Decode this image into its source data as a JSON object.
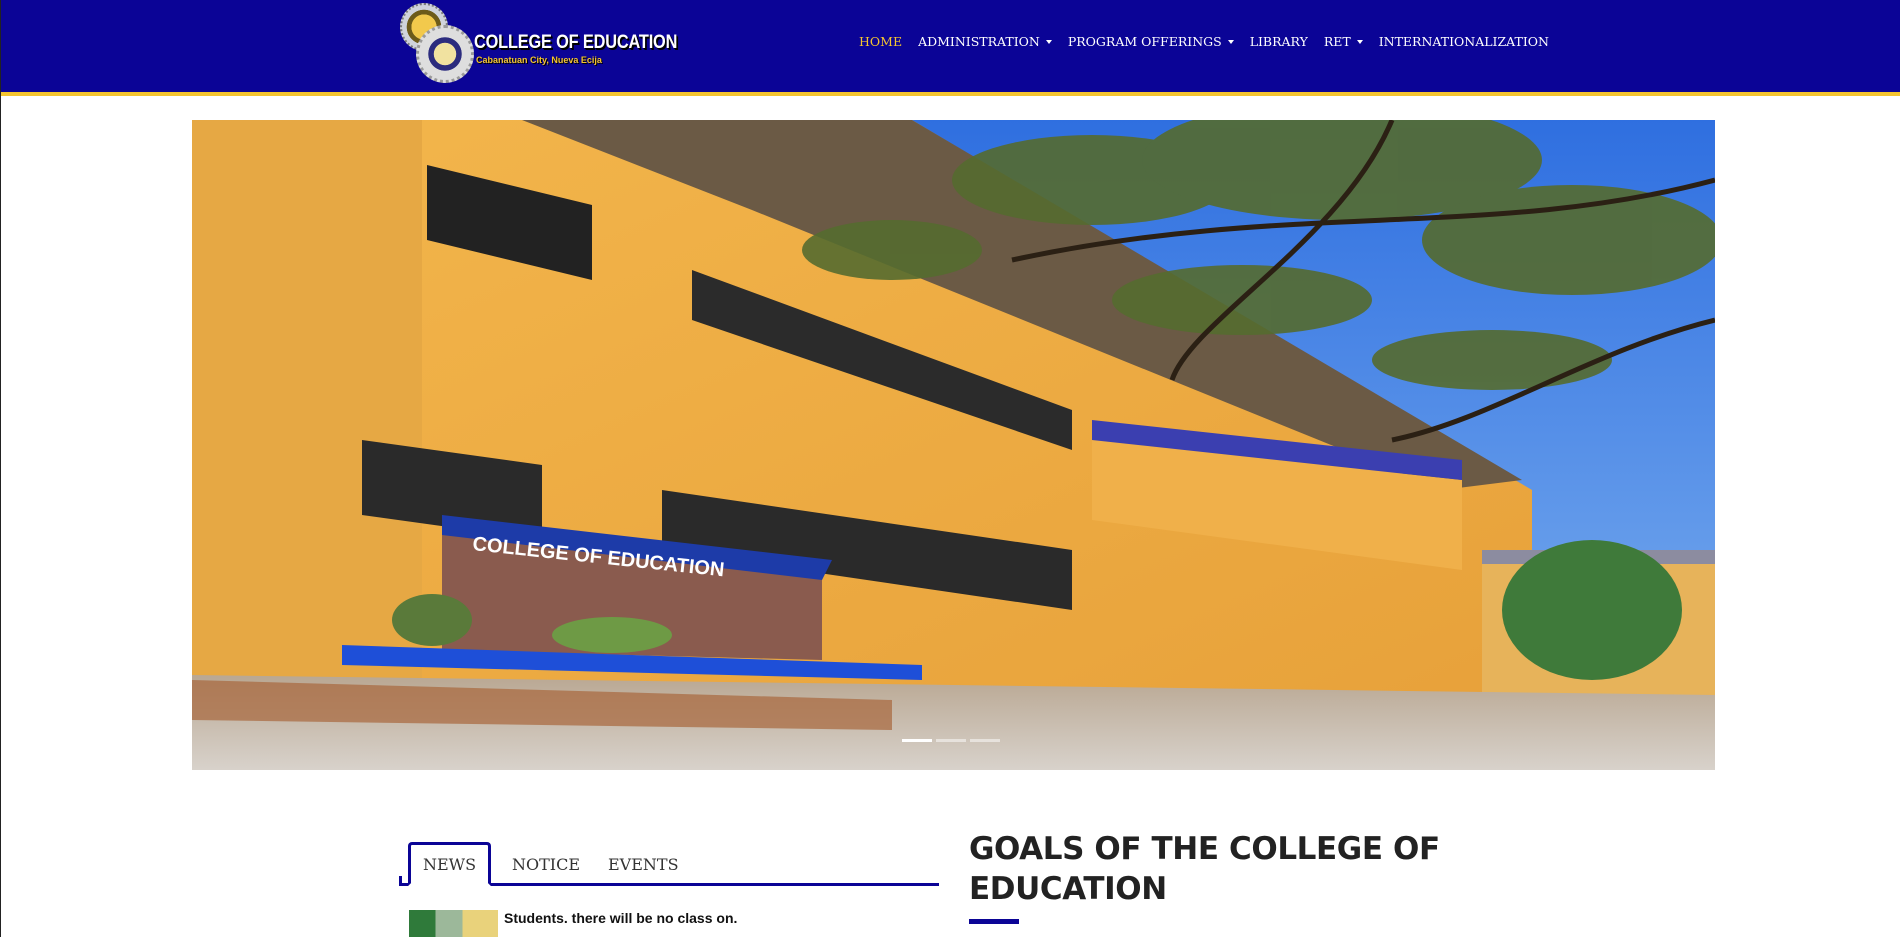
{
  "header": {
    "logo_title": "COLLEGE OF EDUCATION",
    "logo_subtitle": "Cabanatuan City, Nueva Ecija",
    "colors": {
      "bar": "#0b0496",
      "accent": "#f4c430"
    }
  },
  "nav": {
    "items": [
      {
        "label": "HOME",
        "active": true,
        "dropdown": false
      },
      {
        "label": "ADMINISTRATION",
        "active": false,
        "dropdown": true
      },
      {
        "label": "PROGRAM OFFERINGS",
        "active": false,
        "dropdown": true
      },
      {
        "label": "LIBRARY",
        "active": false,
        "dropdown": false
      },
      {
        "label": "RET",
        "active": false,
        "dropdown": true
      },
      {
        "label": "INTERNATIONALIZATION",
        "active": false,
        "dropdown": false
      }
    ]
  },
  "hero": {
    "sign_text": "COLLEGE OF EDUCATION",
    "slide_count": 3,
    "active_slide": 1
  },
  "tabs": {
    "items": [
      {
        "label": "NEWS",
        "active": true
      },
      {
        "label": "NOTICE",
        "active": false
      },
      {
        "label": "EVENTS",
        "active": false
      }
    ],
    "news_items": [
      {
        "text": "Students. there will be no class on."
      }
    ]
  },
  "goals": {
    "title_line1": "GOALS OF THE COLLEGE OF",
    "title_line2": "EDUCATION"
  }
}
